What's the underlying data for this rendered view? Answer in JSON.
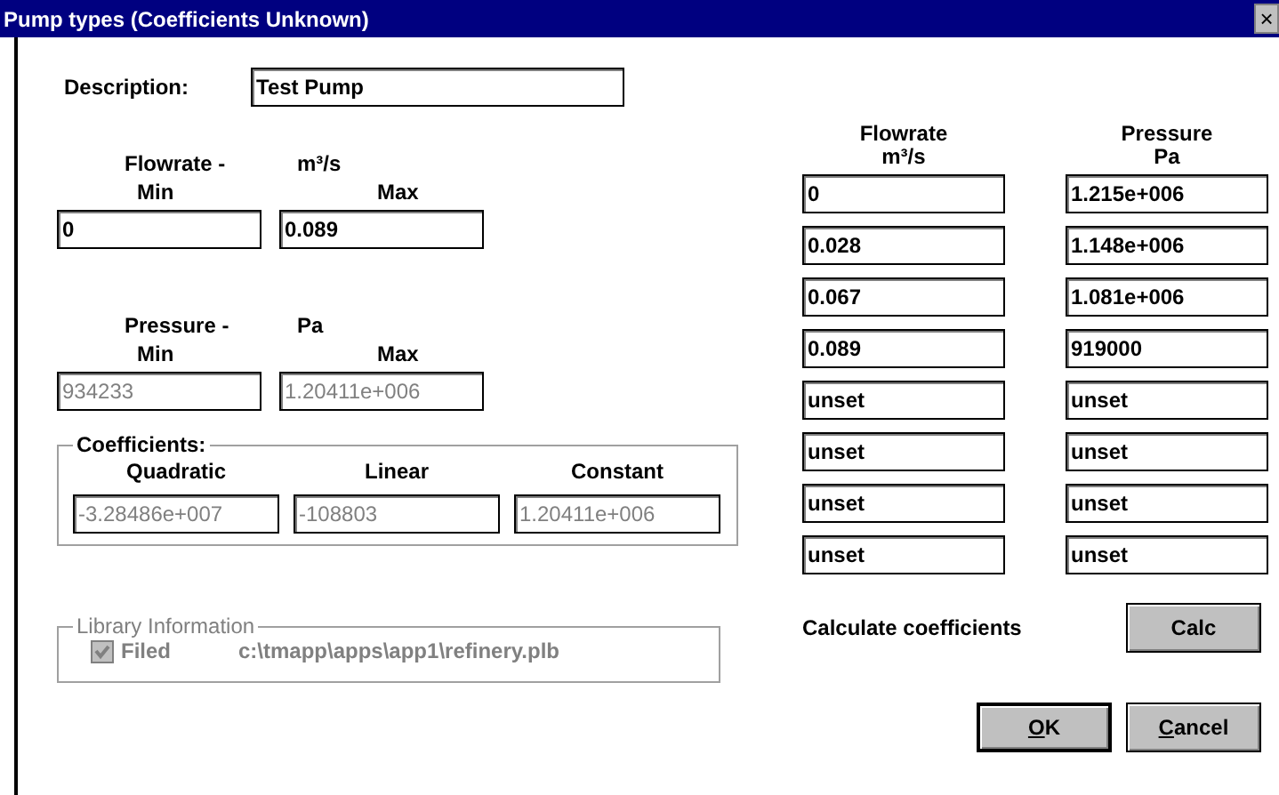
{
  "window": {
    "title": "Pump types (Coefficients Unknown)",
    "close": "×"
  },
  "description": {
    "label": "Description:",
    "value": "Test Pump"
  },
  "flowrate_range": {
    "label": "Flowrate -",
    "unit": "m³/s",
    "min_label": "Min",
    "max_label": "Max",
    "min": {
      "value": "0",
      "disabled": false
    },
    "max": {
      "value": "0.089",
      "disabled": false
    }
  },
  "pressure_range": {
    "label": "Pressure -",
    "unit": "Pa",
    "min_label": "Min",
    "max_label": "Max",
    "min": {
      "value": "934233",
      "disabled": true
    },
    "max": {
      "value": "1.20411e+006",
      "disabled": true
    }
  },
  "coefficients": {
    "title": "Coefficients:",
    "columns": [
      {
        "label": "Quadratic",
        "value": "-3.28486e+007",
        "disabled": true
      },
      {
        "label": "Linear",
        "value": "-108803",
        "disabled": true
      },
      {
        "label": "Constant",
        "value": "1.20411e+006",
        "disabled": true
      }
    ]
  },
  "library": {
    "title": "Library Information",
    "disabled": true,
    "filed": {
      "label": "Filed",
      "checked": true
    },
    "path": "c:\\tmapp\\apps\\app1\\refinery.plb"
  },
  "table": {
    "columns": [
      {
        "label": "Flowrate",
        "unit": "m³/s"
      },
      {
        "label": "Pressure",
        "unit": "Pa"
      }
    ],
    "rows": [
      [
        "0",
        "1.215e+006"
      ],
      [
        "0.028",
        "1.148e+006"
      ],
      [
        "0.067",
        "1.081e+006"
      ],
      [
        "0.089",
        "919000"
      ],
      [
        "unset",
        "unset"
      ],
      [
        "unset",
        "unset"
      ],
      [
        "unset",
        "unset"
      ],
      [
        "unset",
        "unset"
      ]
    ]
  },
  "calculate": {
    "label": "Calculate coefficients",
    "button": "Calc"
  },
  "buttons": [
    {
      "mnemonic": "O",
      "rest": "K",
      "default": true
    },
    {
      "mnemonic": "C",
      "rest": "ancel",
      "default": false
    }
  ]
}
